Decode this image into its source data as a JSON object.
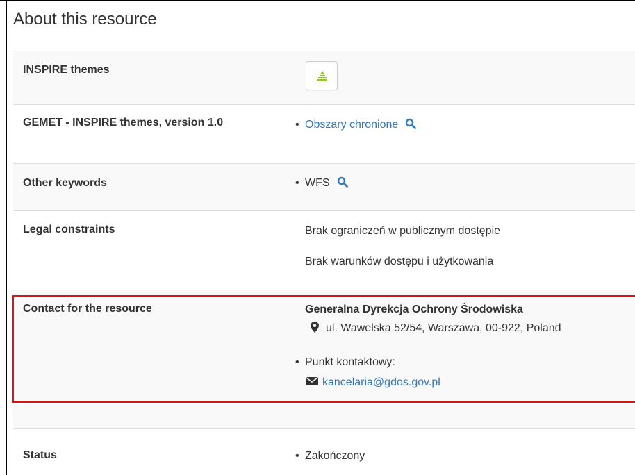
{
  "section": {
    "title": "About this resource"
  },
  "rows": {
    "inspire": {
      "label": "INSPIRE themes",
      "theme_icon": "protected-sites-icon"
    },
    "gemet": {
      "label": "GEMET - INSPIRE themes, version 1.0",
      "keyword": "Obszary chronione"
    },
    "other": {
      "label": "Other keywords",
      "keyword": "WFS"
    },
    "legal": {
      "label": "Legal constraints",
      "line1": "Brak ograniczeń w publicznym dostępie",
      "line2": "Brak warunków dostępu i użytkowania"
    },
    "contact": {
      "label": "Contact for the resource",
      "org": "Generalna Dyrekcja Ochrony Środowiska",
      "address": "ul. Wawelska 52/54, Warszawa, 00-922, Poland",
      "role": "Punkt kontaktowy:",
      "email": "kancelaria@gdos.gov.pl"
    },
    "status": {
      "label": "Status",
      "value": "Zakończony"
    }
  },
  "colors": {
    "link": "#337ab7",
    "highlight": "#e01010",
    "theme_icon": "#8fc43a"
  }
}
